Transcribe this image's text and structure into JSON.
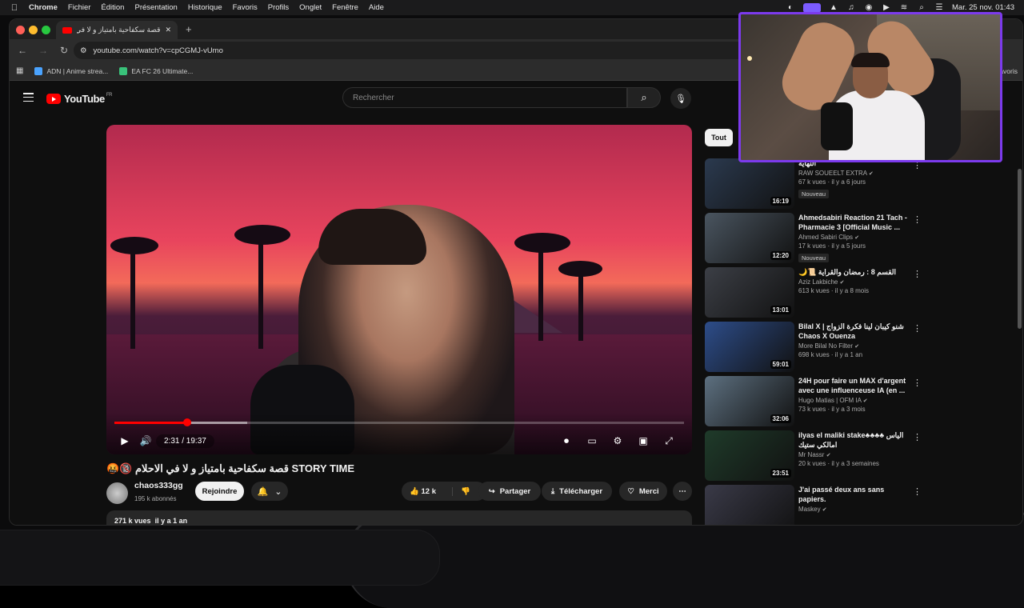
{
  "menubar": {
    "app": "Chrome",
    "items": [
      "Fichier",
      "Édition",
      "Présentation",
      "Historique",
      "Favoris",
      "Profils",
      "Onglet",
      "Fenêtre",
      "Aide"
    ],
    "clock": "Mar. 25 nov. 01:43"
  },
  "browser": {
    "tab_title": "قصة سكفاحية بامتياز و لا في الاحلام",
    "url": "youtube.com/watch?v=cpCGMJ-vUmo",
    "bookmarks": [
      "ADN | Anime strea...",
      "EA FC 26 Ultimate..."
    ],
    "favoris_label": "Favoris"
  },
  "youtube": {
    "logo": "YouTube",
    "region": "FR",
    "search_placeholder": "Rechercher"
  },
  "player": {
    "time": "2:31 / 19:37",
    "progress": 0.128
  },
  "video": {
    "title": "🤬🔞 قصة سكفاحية بامتياز و لا في الاحلام STORY TIME",
    "channel": "chaos333gg",
    "subscribers": "195 k abonnés",
    "join_label": "Rejoindre",
    "likes": "12 k",
    "share_label": "Partager",
    "download_label": "Télécharger",
    "thanks_label": "Merci",
    "desc_views": "271 k vues",
    "desc_date": "il y a 1 an"
  },
  "sidebar": {
    "chip": "Tout",
    "items": [
      {
        "title": "النهاية",
        "channel": "RAW SOUEELT EXTRA",
        "views": "67 k vues · il y a 6 jours",
        "duration": "16:19",
        "badge": "Nouveau",
        "color": "#2b3a4f"
      },
      {
        "title": "Ahmedsabiri Reaction 21 Tach - Pharmacie 3 [Official Music ...",
        "channel": "Ahmed Sabiri Clips",
        "views": "17 k vues · il y a 5 jours",
        "duration": "12:20",
        "badge": "Nouveau",
        "color": "#4a5560"
      },
      {
        "title": "🌙📜 القسم 8 : رمضان والقراية",
        "channel": "Aziz Lakbiche",
        "views": "613 k vues · il y a 8 mois",
        "duration": "13:01",
        "badge": "",
        "color": "#3c3f46"
      },
      {
        "title": "Bilal X | شنو كيبان لينا فكرة الزواج Chaos X Ouenza",
        "channel": "More Bilal No Filter",
        "views": "698 k vues · il y a 1 an",
        "duration": "59:01",
        "badge": "",
        "color": "#2d4d8a"
      },
      {
        "title": "24H pour faire un MAX d'argent avec une influenceuse IA (en ...",
        "channel": "Hugo Matias | OFM IA",
        "views": "73 k vues · il y a 3 mois",
        "duration": "32:06",
        "badge": "",
        "color": "#5d7080"
      },
      {
        "title": "ilyas el maliki stake♣♣♣♣ الياس امالكي ستيك",
        "channel": "Mr Nassr",
        "views": "20 k vues · il y a 3 semaines",
        "duration": "23:51",
        "badge": "",
        "color": "#1f3b2a"
      },
      {
        "title": "J'ai passé deux ans sans papiers.",
        "channel": "Maskey",
        "views": "",
        "duration": "",
        "badge": "",
        "color": "#3a3a48"
      }
    ]
  }
}
